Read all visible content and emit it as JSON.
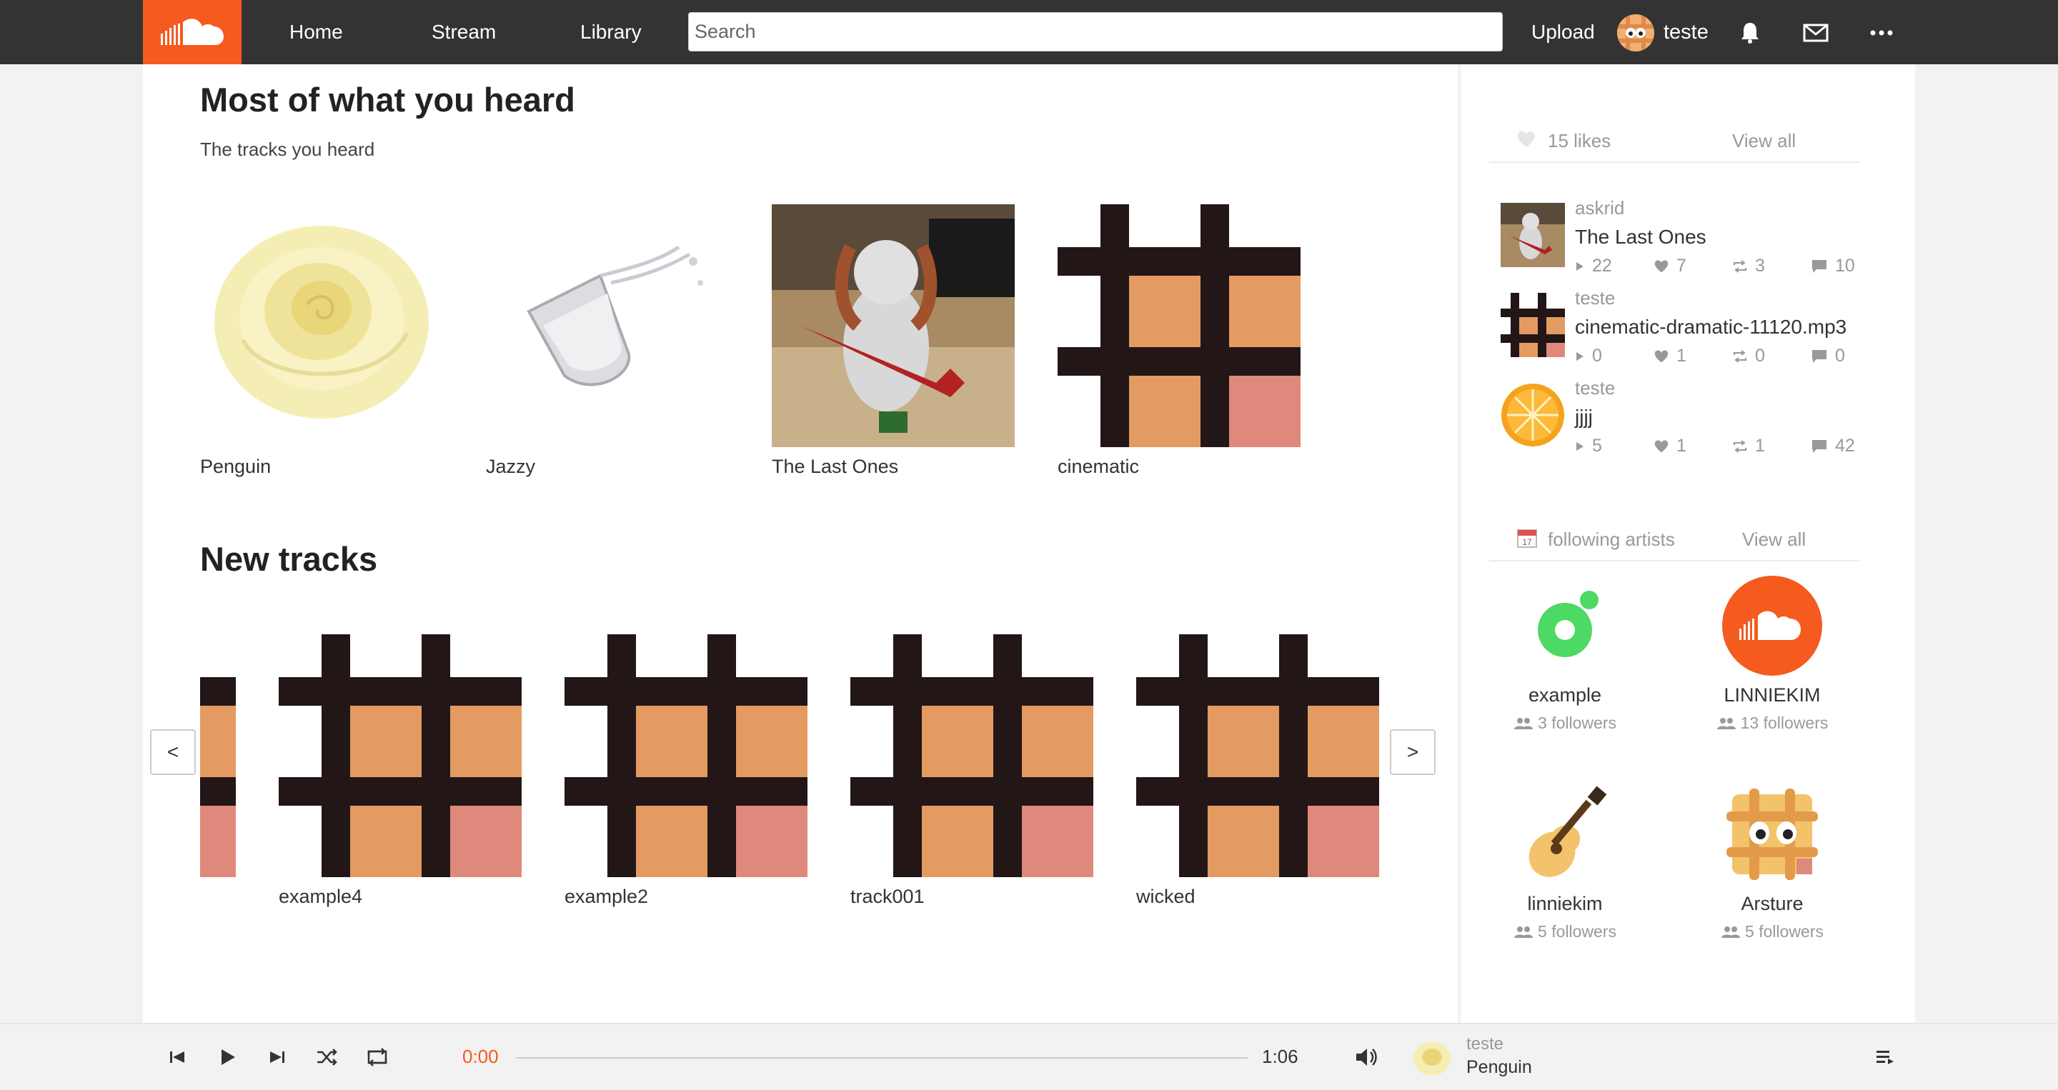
{
  "nav": {
    "home": "Home",
    "stream": "Stream",
    "library": "Library",
    "search_placeholder": "Search",
    "upload": "Upload",
    "username": "teste"
  },
  "most_heard": {
    "title": "Most of what you heard",
    "subtitle": "The tracks you heard",
    "tracks": [
      {
        "title": "Penguin",
        "art": "yellow-rose"
      },
      {
        "title": "Jazzy",
        "art": "water-glass"
      },
      {
        "title": "The Last Ones",
        "art": "cat-guitar-photo"
      },
      {
        "title": "cinematic",
        "art": "grid-pattern"
      }
    ]
  },
  "new_tracks": {
    "title": "New tracks",
    "prev_label": "<",
    "next_label": ">",
    "tracks": [
      {
        "title": "example4",
        "art": "grid-pattern"
      },
      {
        "title": "example2",
        "art": "grid-pattern"
      },
      {
        "title": "track001",
        "art": "grid-pattern"
      },
      {
        "title": "wicked",
        "art": "grid-pattern"
      }
    ]
  },
  "likes": {
    "count_label": "15 likes",
    "view_all": "View all",
    "items": [
      {
        "user": "askrid",
        "title": "The Last Ones",
        "plays": "22",
        "likes": "7",
        "reposts": "3",
        "comments": "10"
      },
      {
        "user": "teste",
        "title": "cinematic-dramatic-11120.mp3",
        "plays": "0",
        "likes": "1",
        "reposts": "0",
        "comments": "0"
      },
      {
        "user": "teste",
        "title": "jjjj",
        "plays": "5",
        "likes": "1",
        "reposts": "1",
        "comments": "42"
      }
    ]
  },
  "following": {
    "label": "following artists",
    "view_all": "View all",
    "artists": [
      {
        "name": "example",
        "followers": "3 followers"
      },
      {
        "name": "LINNIEKIM",
        "followers": "13 followers"
      },
      {
        "name": "linniekim",
        "followers": "5 followers"
      },
      {
        "name": "Arsture",
        "followers": "5 followers"
      }
    ]
  },
  "player": {
    "current_time": "0:00",
    "duration": "1:06",
    "progress": 0,
    "user": "teste",
    "title": "Penguin"
  },
  "colors": {
    "brand": "#f55a1e",
    "topbar": "#333333",
    "grid_dark": "#231617",
    "grid_orange": "#e39b62",
    "grid_pink": "#df897c"
  }
}
